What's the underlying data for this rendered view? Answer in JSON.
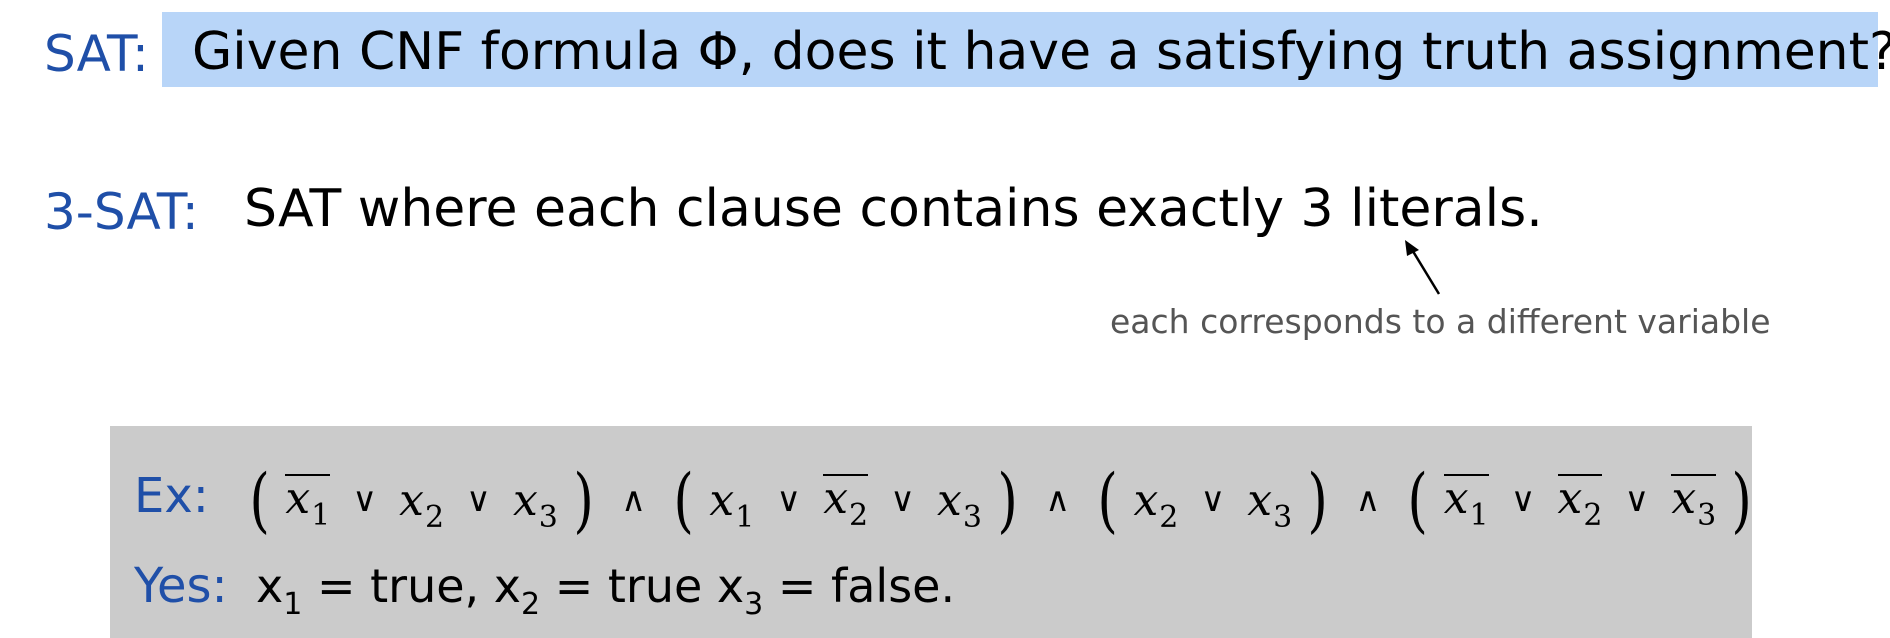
{
  "sat": {
    "label": "SAT:",
    "text": "Given CNF formula Φ, does it have a satisfying truth assignment?"
  },
  "threesat": {
    "label": "3-SAT:",
    "text": "SAT where each clause contains exactly 3 literals."
  },
  "annotation": {
    "text": "each corresponds to a different variable"
  },
  "example": {
    "ex_label": "Ex:",
    "yes_label": "Yes:",
    "or_symbol": "∨",
    "and_symbol": "∧",
    "open_paren": "(",
    "close_paren": ")",
    "variable": "x",
    "clauses": [
      [
        {
          "sub": "1",
          "neg": true
        },
        {
          "sub": "2",
          "neg": false
        },
        {
          "sub": "3",
          "neg": false
        }
      ],
      [
        {
          "sub": "1",
          "neg": false
        },
        {
          "sub": "2",
          "neg": true
        },
        {
          "sub": "3",
          "neg": false
        }
      ],
      [
        {
          "sub": "2",
          "neg": false
        },
        {
          "sub": "3",
          "neg": false
        }
      ],
      [
        {
          "sub": "1",
          "neg": true
        },
        {
          "sub": "2",
          "neg": true
        },
        {
          "sub": "3",
          "neg": true
        }
      ]
    ],
    "assignment": [
      {
        "var": "x",
        "sub": "1",
        "rest": " = true,"
      },
      {
        "var": "x",
        "sub": "2",
        "rest": " = true"
      },
      {
        "var": "x",
        "sub": "3",
        "rest": " = false."
      }
    ]
  },
  "colors": {
    "label_blue": "#1f4fa8",
    "highlight": "#b8d5f8",
    "example_bg": "#cbcbcb",
    "annotation_gray": "#555555"
  }
}
